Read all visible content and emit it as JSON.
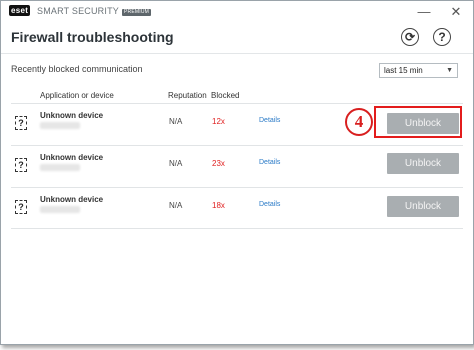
{
  "titlebar": {
    "logo": "eset",
    "product": "SMART SECURITY",
    "edition": "PREMIUM",
    "minimize_glyph": "—",
    "close_glyph": "✕"
  },
  "header": {
    "title": "Firewall troubleshooting",
    "refresh_glyph": "⟳",
    "help_glyph": "?"
  },
  "section": {
    "label": "Recently blocked communication",
    "time_filter": "last 15 min"
  },
  "columns": {
    "app": "Application or device",
    "reputation": "Reputation",
    "blocked": "Blocked"
  },
  "rows": [
    {
      "icon": "?",
      "name": "Unknown device",
      "reputation": "N/A",
      "blocked": "12x",
      "details": "Details",
      "action": "Unblock"
    },
    {
      "icon": "?",
      "name": "Unknown device",
      "reputation": "N/A",
      "blocked": "23x",
      "details": "Details",
      "action": "Unblock"
    },
    {
      "icon": "?",
      "name": "Unknown device",
      "reputation": "N/A",
      "blocked": "18x",
      "details": "Details",
      "action": "Unblock"
    }
  ],
  "annotation": {
    "step": "4"
  },
  "colors": {
    "accent_red": "#e31c1c",
    "link": "#2a7ac7",
    "button_gray": "#a9aeb1"
  }
}
